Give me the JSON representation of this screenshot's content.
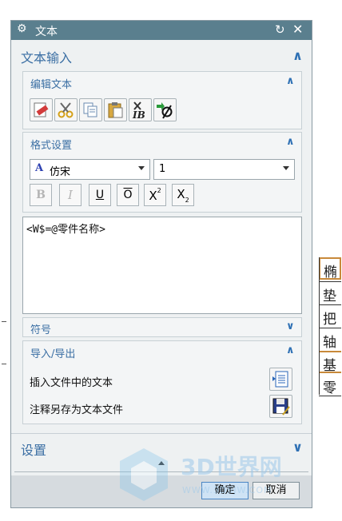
{
  "dialog": {
    "title": "文本",
    "icons": {
      "settings": "gear-icon",
      "reset": "reset-icon",
      "close": "close-icon"
    }
  },
  "text_input_section": {
    "label": "文本输入"
  },
  "edit_text": {
    "label": "编辑文本",
    "tools": [
      "eraser-icon",
      "cut-icon",
      "copy-icon",
      "paste-icon",
      "delete-attribute-icon",
      "insert-symbol-icon"
    ]
  },
  "format": {
    "label": "格式设置",
    "font_value": "仿宋",
    "font_glyph": "A",
    "size_value": "1",
    "buttons": {
      "bold": "B",
      "italic": "I",
      "underline": "U",
      "overline": "O",
      "superscript": "X",
      "superscript_mark": "2",
      "subscript": "X",
      "subscript_mark": "2"
    }
  },
  "editor": {
    "content": "<W$=@零件名称>"
  },
  "symbols_section": {
    "label": "符号"
  },
  "import_export": {
    "label": "导入/导出",
    "insert_label": "插入文件中的文本",
    "save_label": "注释另存为文本文件"
  },
  "settings_section": {
    "label": "设置"
  },
  "buttons": {
    "ok": "确定",
    "cancel": "取消"
  },
  "background_table": {
    "cells": [
      "椭",
      "垫",
      "把",
      "轴",
      "基",
      "零"
    ]
  },
  "watermark": {
    "brand": "3D世界网",
    "url": "WWW.3DSJW.COM"
  },
  "colors": {
    "titlebar": "#5a7f8e",
    "accent": "#3b6fa4",
    "highlight_border": "#c8893a"
  }
}
